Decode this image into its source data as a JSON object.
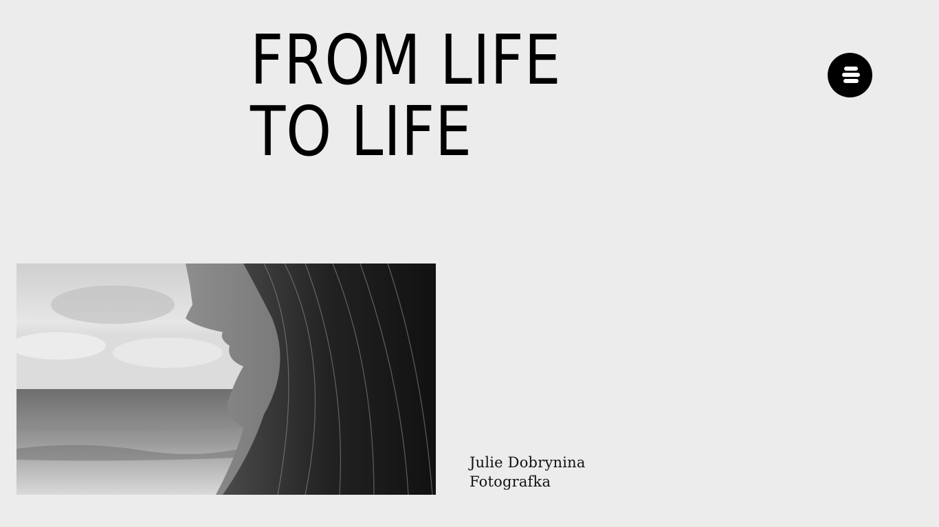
{
  "hero": {
    "line1": "FROM LIFE",
    "line2": "TO LIFE"
  },
  "menu": {
    "icon": "hamburger-menu-icon",
    "background": "#000000"
  },
  "caption": {
    "name": "Julie Dobrynina",
    "role": "Fotografka"
  },
  "colors": {
    "background": "#ececec",
    "text": "#000000"
  }
}
